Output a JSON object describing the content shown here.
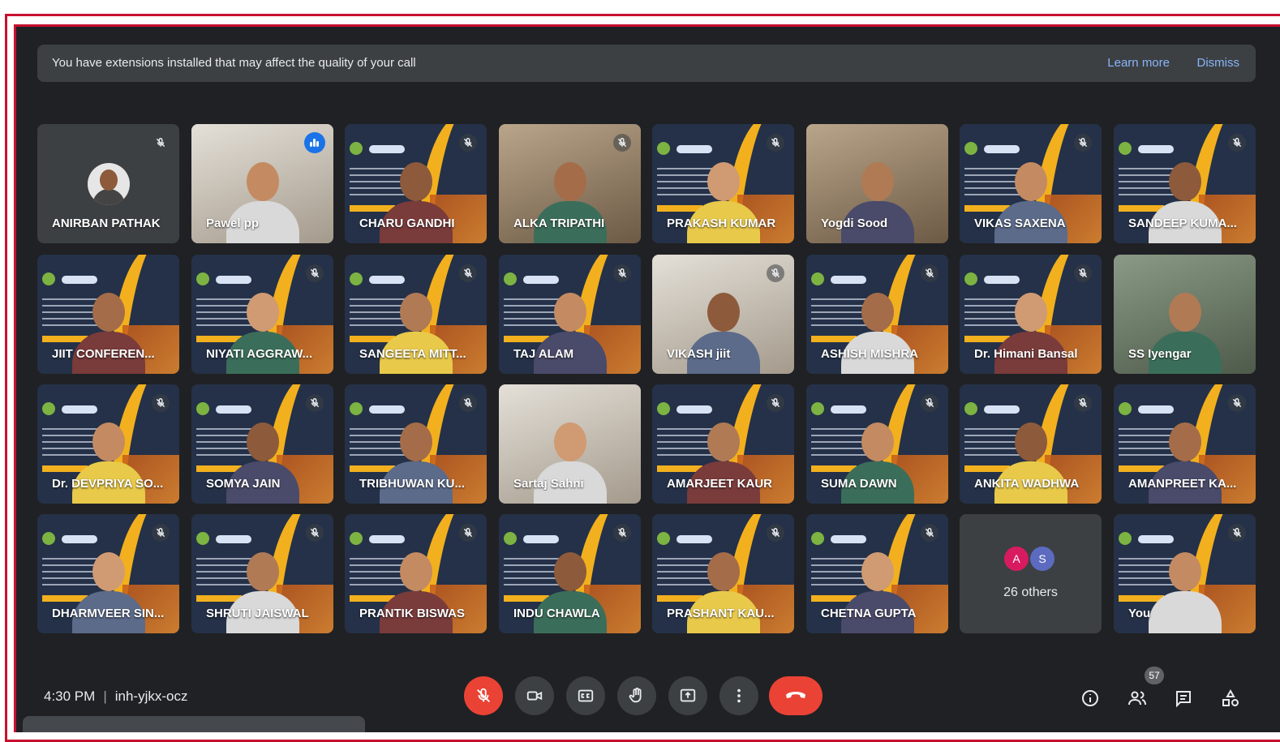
{
  "banner": {
    "message": "You have extensions installed that may affect the quality of your call",
    "learn_more": "Learn more",
    "dismiss": "Dismiss"
  },
  "participants": [
    {
      "name": "ANIRBAN PATHAK",
      "bg": "avatar",
      "muted": true
    },
    {
      "name": "Pawel pp",
      "bg": "room2",
      "muted": false,
      "speaking": true
    },
    {
      "name": "CHARU GANDHI",
      "bg": "poster",
      "muted": true
    },
    {
      "name": "ALKA TRIPATHI",
      "bg": "room",
      "muted": true
    },
    {
      "name": "PRAKASH KUMAR",
      "bg": "poster",
      "muted": true
    },
    {
      "name": "Yogdi Sood",
      "bg": "room",
      "muted": false
    },
    {
      "name": "VIKAS SAXENA",
      "bg": "poster",
      "muted": true
    },
    {
      "name": "SANDEEP KUMA...",
      "bg": "poster",
      "muted": true
    },
    {
      "name": "JIIT CONFEREN...",
      "bg": "poster",
      "muted": false
    },
    {
      "name": "NIYATI AGGRAW...",
      "bg": "poster",
      "muted": true
    },
    {
      "name": "SANGEETA MITT...",
      "bg": "poster",
      "muted": true
    },
    {
      "name": "TAJ ALAM",
      "bg": "poster",
      "muted": true
    },
    {
      "name": "VIKASH jiit",
      "bg": "room2",
      "muted": true
    },
    {
      "name": "ASHISH MISHRA",
      "bg": "poster",
      "muted": true
    },
    {
      "name": "Dr. Himani Bansal",
      "bg": "poster",
      "muted": true
    },
    {
      "name": "SS Iyengar",
      "bg": "room3",
      "muted": false
    },
    {
      "name": "Dr. DEVPRIYA SO...",
      "bg": "poster",
      "muted": true
    },
    {
      "name": "SOMYA JAIN",
      "bg": "poster",
      "muted": true
    },
    {
      "name": "TRIBHUWAN KU...",
      "bg": "poster",
      "muted": true
    },
    {
      "name": "Sartaj Sahni",
      "bg": "room2",
      "muted": false
    },
    {
      "name": "AMARJEET KAUR",
      "bg": "poster",
      "muted": true
    },
    {
      "name": "SUMA DAWN",
      "bg": "poster",
      "muted": true
    },
    {
      "name": "ANKITA WADHWA",
      "bg": "poster",
      "muted": true
    },
    {
      "name": "AMANPREET KA...",
      "bg": "poster",
      "muted": true
    },
    {
      "name": "DHARMVEER SIN...",
      "bg": "poster",
      "muted": true
    },
    {
      "name": "SHRUTI JAISWAL",
      "bg": "poster",
      "muted": true
    },
    {
      "name": "PRANTIK BISWAS",
      "bg": "poster",
      "muted": true
    },
    {
      "name": "INDU CHAWLA",
      "bg": "poster",
      "muted": true
    },
    {
      "name": "PRASHANT KAU...",
      "bg": "poster",
      "muted": true
    },
    {
      "name": "CHETNA GUPTA",
      "bg": "poster",
      "muted": true
    },
    {
      "name": "",
      "bg": "others",
      "muted": false
    },
    {
      "name": "You",
      "bg": "poster",
      "muted": true
    }
  ],
  "others": {
    "label": "26 others",
    "avatars": [
      {
        "letter": "A",
        "color": "#d81b60"
      },
      {
        "letter": "S",
        "color": "#5c6bc0"
      }
    ]
  },
  "footer": {
    "time": "4:30 PM",
    "meeting_code": "inh-yjkx-ocz",
    "people_count": "57"
  },
  "controls": [
    "microphone-muted",
    "camera",
    "captions",
    "raise-hand",
    "present",
    "more-options",
    "leave-call"
  ],
  "colors": {
    "background": "#202124",
    "tile": "#3c4043",
    "accent_blue": "#8ab4f8",
    "danger_red": "#ea4335",
    "frame_red": "#c8102e"
  }
}
